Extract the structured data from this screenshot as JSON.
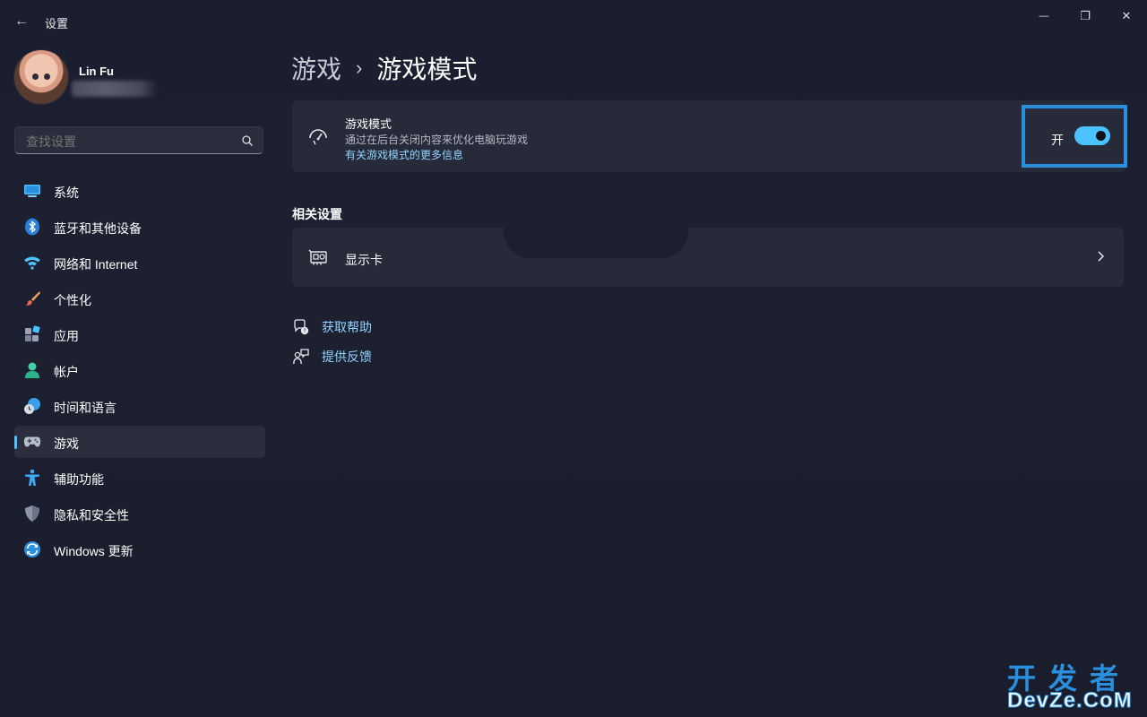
{
  "window": {
    "title": "设置",
    "back_glyph": "←",
    "minimize_glyph": "—",
    "maximize_glyph": "❐",
    "close_glyph": "✕"
  },
  "profile": {
    "name": "Lin Fu"
  },
  "search": {
    "placeholder": "查找设置"
  },
  "sidebar": {
    "items": [
      {
        "label": "系统",
        "icon": "monitor-icon"
      },
      {
        "label": "蓝牙和其他设备",
        "icon": "bluetooth-icon"
      },
      {
        "label": "网络和 Internet",
        "icon": "wifi-icon"
      },
      {
        "label": "个性化",
        "icon": "brush-icon"
      },
      {
        "label": "应用",
        "icon": "apps-icon"
      },
      {
        "label": "帐户",
        "icon": "account-icon"
      },
      {
        "label": "时间和语言",
        "icon": "globe-clock-icon"
      },
      {
        "label": "游戏",
        "icon": "gamepad-icon",
        "active": true
      },
      {
        "label": "辅助功能",
        "icon": "accessibility-icon"
      },
      {
        "label": "隐私和安全性",
        "icon": "shield-icon"
      },
      {
        "label": "Windows 更新",
        "icon": "update-icon"
      }
    ]
  },
  "breadcrumb": {
    "parent": "游戏",
    "separator": "›",
    "current": "游戏模式"
  },
  "game_mode": {
    "title": "游戏模式",
    "description": "通过在后台关闭内容来优化电脑玩游戏",
    "link": "有关游戏模式的更多信息",
    "toggle_label": "开",
    "toggle_on": true
  },
  "related": {
    "heading": "相关设置",
    "graphics_label": "显示卡"
  },
  "help": {
    "get_help": "获取帮助",
    "feedback": "提供反馈"
  },
  "watermark": {
    "top": "开发者",
    "bottom": "DevZe.CoM"
  },
  "colors": {
    "accent": "#4cc2ff",
    "link": "#8fd4ff",
    "highlight_border": "#2a8fdc",
    "card": "#262a39",
    "background": "#1b1e2e"
  }
}
